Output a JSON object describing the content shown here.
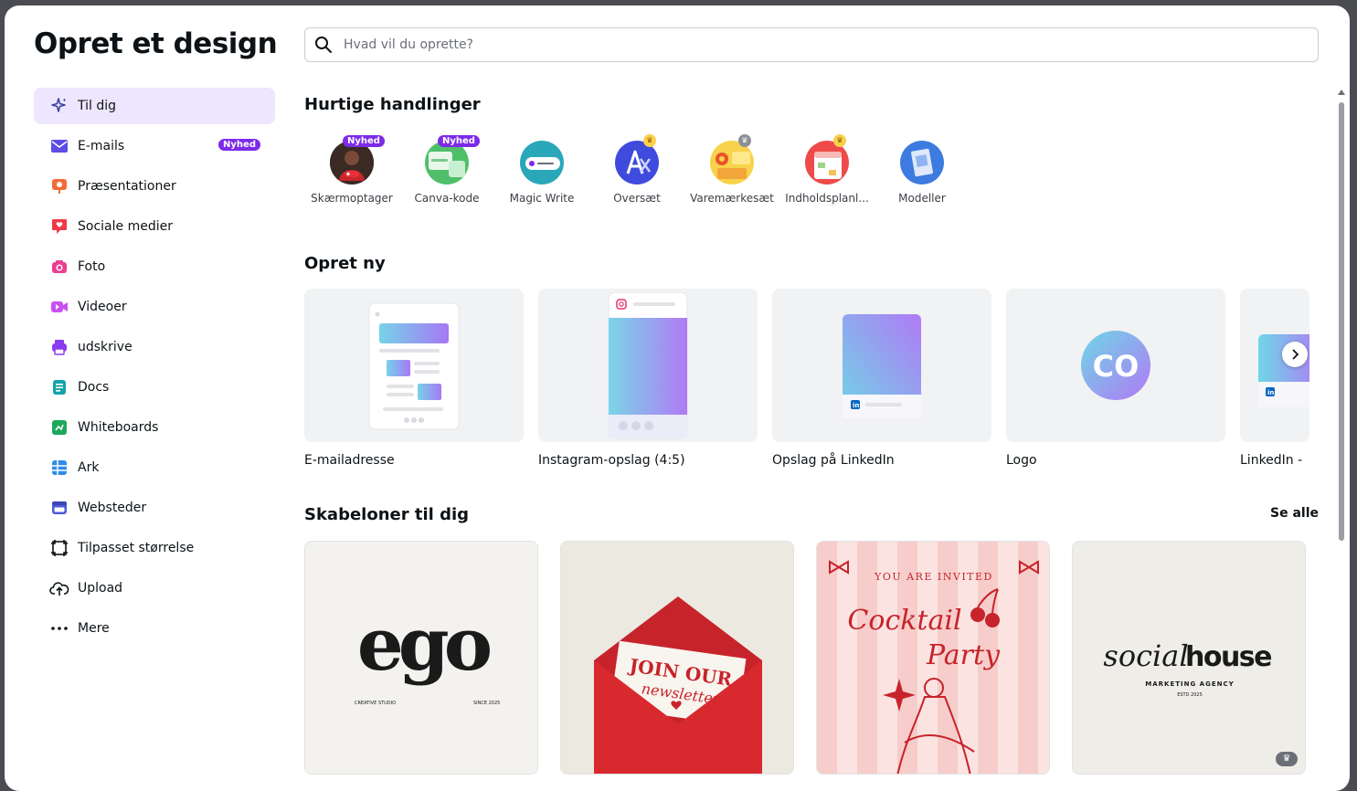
{
  "dialog": {
    "title": "Opret et design",
    "search_placeholder": "Hvad vil du oprette?"
  },
  "sidebar": {
    "items": [
      {
        "label": "Til dig",
        "icon": "sparkle-icon",
        "active": true
      },
      {
        "label": "E-mails",
        "icon": "envelope-icon",
        "badge": "Nyhed"
      },
      {
        "label": "Præsentationer",
        "icon": "presentation-icon"
      },
      {
        "label": "Sociale medier",
        "icon": "heart-chat-icon"
      },
      {
        "label": "Foto",
        "icon": "camera-icon"
      },
      {
        "label": "Videoer",
        "icon": "video-camera-icon"
      },
      {
        "label": "udskrive",
        "icon": "printer-icon"
      },
      {
        "label": "Docs",
        "icon": "document-icon"
      },
      {
        "label": "Whiteboards",
        "icon": "whiteboard-icon"
      },
      {
        "label": "Ark",
        "icon": "sheet-grid-icon"
      },
      {
        "label": "Websteder",
        "icon": "website-icon"
      },
      {
        "label": "Tilpasset størrelse",
        "icon": "resize-icon"
      },
      {
        "label": "Upload",
        "icon": "cloud-upload-icon"
      },
      {
        "label": "Mere",
        "icon": "more-dots-icon"
      }
    ]
  },
  "quick_actions": {
    "title": "Hurtige handlinger",
    "items": [
      {
        "label": "Skærmoptager",
        "badge": "Nyhed",
        "icon": "screen-recorder-icon"
      },
      {
        "label": "Canva-kode",
        "badge": "Nyhed",
        "icon": "code-icon"
      },
      {
        "label": "Magic Write",
        "icon": "magic-write-icon"
      },
      {
        "label": "Oversæt",
        "crown": true,
        "icon": "translate-icon"
      },
      {
        "label": "Varemærkesæt",
        "crown": true,
        "icon": "brand-kit-icon"
      },
      {
        "label": "Indholdsplanl...",
        "crown": true,
        "icon": "content-planner-icon"
      },
      {
        "label": "Modeller",
        "icon": "mockups-icon"
      }
    ]
  },
  "create_new": {
    "title": "Opret ny",
    "items": [
      {
        "label": "E-mailadresse"
      },
      {
        "label": "Instagram-opslag (4:5)"
      },
      {
        "label": "Opslag på LinkedIn"
      },
      {
        "label": "Logo",
        "logo_text": "CO"
      },
      {
        "label": "LinkedIn -"
      }
    ]
  },
  "templates": {
    "title": "Skabeloner til dig",
    "see_all": "Se alle",
    "items": [
      {
        "main": "ego",
        "left_small": "CREATIVE STUDIO",
        "right_small": "SINCE 2025"
      },
      {
        "line1": "JOIN OUR",
        "line2": "newsletter"
      },
      {
        "top": "YOU ARE INVITED",
        "line1": "Cocktail",
        "line2": "Party"
      },
      {
        "word1": "social",
        "word2": "house",
        "sub": "MARKETING AGENCY",
        "sub2": "ESTD 2025"
      }
    ]
  },
  "colors": {
    "accent": "#7d2ae8",
    "active_bg": "#ede6fe"
  }
}
